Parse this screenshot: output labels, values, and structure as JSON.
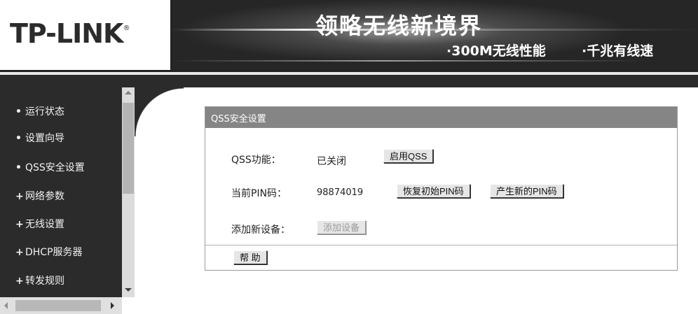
{
  "header": {
    "logo": "TP-LINK",
    "logo_mark": "®",
    "slogan": "领略无线新境界",
    "feature_1": "·300M无线性能",
    "feature_2": "·千兆有线速"
  },
  "sidebar": {
    "items": [
      {
        "mark": "•",
        "label": "运行状态"
      },
      {
        "mark": "•",
        "label": "设置向导"
      },
      {
        "mark": "•",
        "label": "QSS安全设置"
      },
      {
        "mark": "+",
        "label": "网络参数"
      },
      {
        "mark": "+",
        "label": "无线设置"
      },
      {
        "mark": "+",
        "label": "DHCP服务器"
      },
      {
        "mark": "+",
        "label": "转发规则"
      }
    ]
  },
  "panel": {
    "title": "QSS安全设置",
    "qss_label": "QSS功能：",
    "qss_status": "已关闭",
    "enable_button": "启用QSS",
    "pin_label": "当前PIN码：",
    "pin_value": "98874019",
    "restore_pin_button": "恢复初始PIN码",
    "new_pin_button": "产生新的PIN码",
    "add_device_label": "添加新设备：",
    "add_device_button": "添加设备",
    "help_button": "帮 助"
  },
  "colors": {
    "sidebar_bg": "#2b2b2b",
    "panel_title_bg": "#858585"
  }
}
